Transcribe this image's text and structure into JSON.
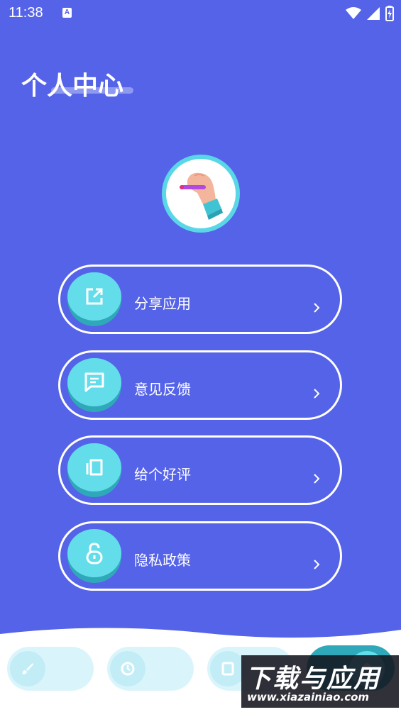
{
  "status_bar": {
    "time": "11:38",
    "notification_glyph": "A"
  },
  "header": {
    "title": "个人中心"
  },
  "menu": [
    {
      "label": "分享应用",
      "icon": "share-icon"
    },
    {
      "label": "意见反馈",
      "icon": "feedback-icon"
    },
    {
      "label": "给个好评",
      "icon": "rate-icon"
    },
    {
      "label": "隐私政策",
      "icon": "privacy-lock-icon"
    }
  ],
  "bottom_nav": [
    {
      "icon": "brush-icon"
    },
    {
      "icon": "clock-icon"
    },
    {
      "icon": "notebook-icon"
    },
    {
      "icon": "profile-icon",
      "active": true
    }
  ],
  "watermark": {
    "title": "下载与应用",
    "url": "www.xiazainiao.com"
  },
  "colors": {
    "background": "#5563e8",
    "accent": "#62dde9",
    "accent_dark": "#2fa9b9",
    "white": "#ffffff"
  }
}
